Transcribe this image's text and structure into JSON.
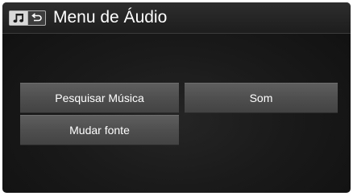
{
  "header": {
    "title": "Menu de Áudio",
    "icons": [
      "music-note-icon",
      "back-arrow-icon"
    ]
  },
  "menu": {
    "pesquisar_musica": "Pesquisar Música",
    "mudar_fonte": "Mudar fonte",
    "som": "Som"
  },
  "colors": {
    "background": "#151515",
    "header_bg": "#262626",
    "button_bg": "#555555",
    "text": "#ffffff"
  }
}
